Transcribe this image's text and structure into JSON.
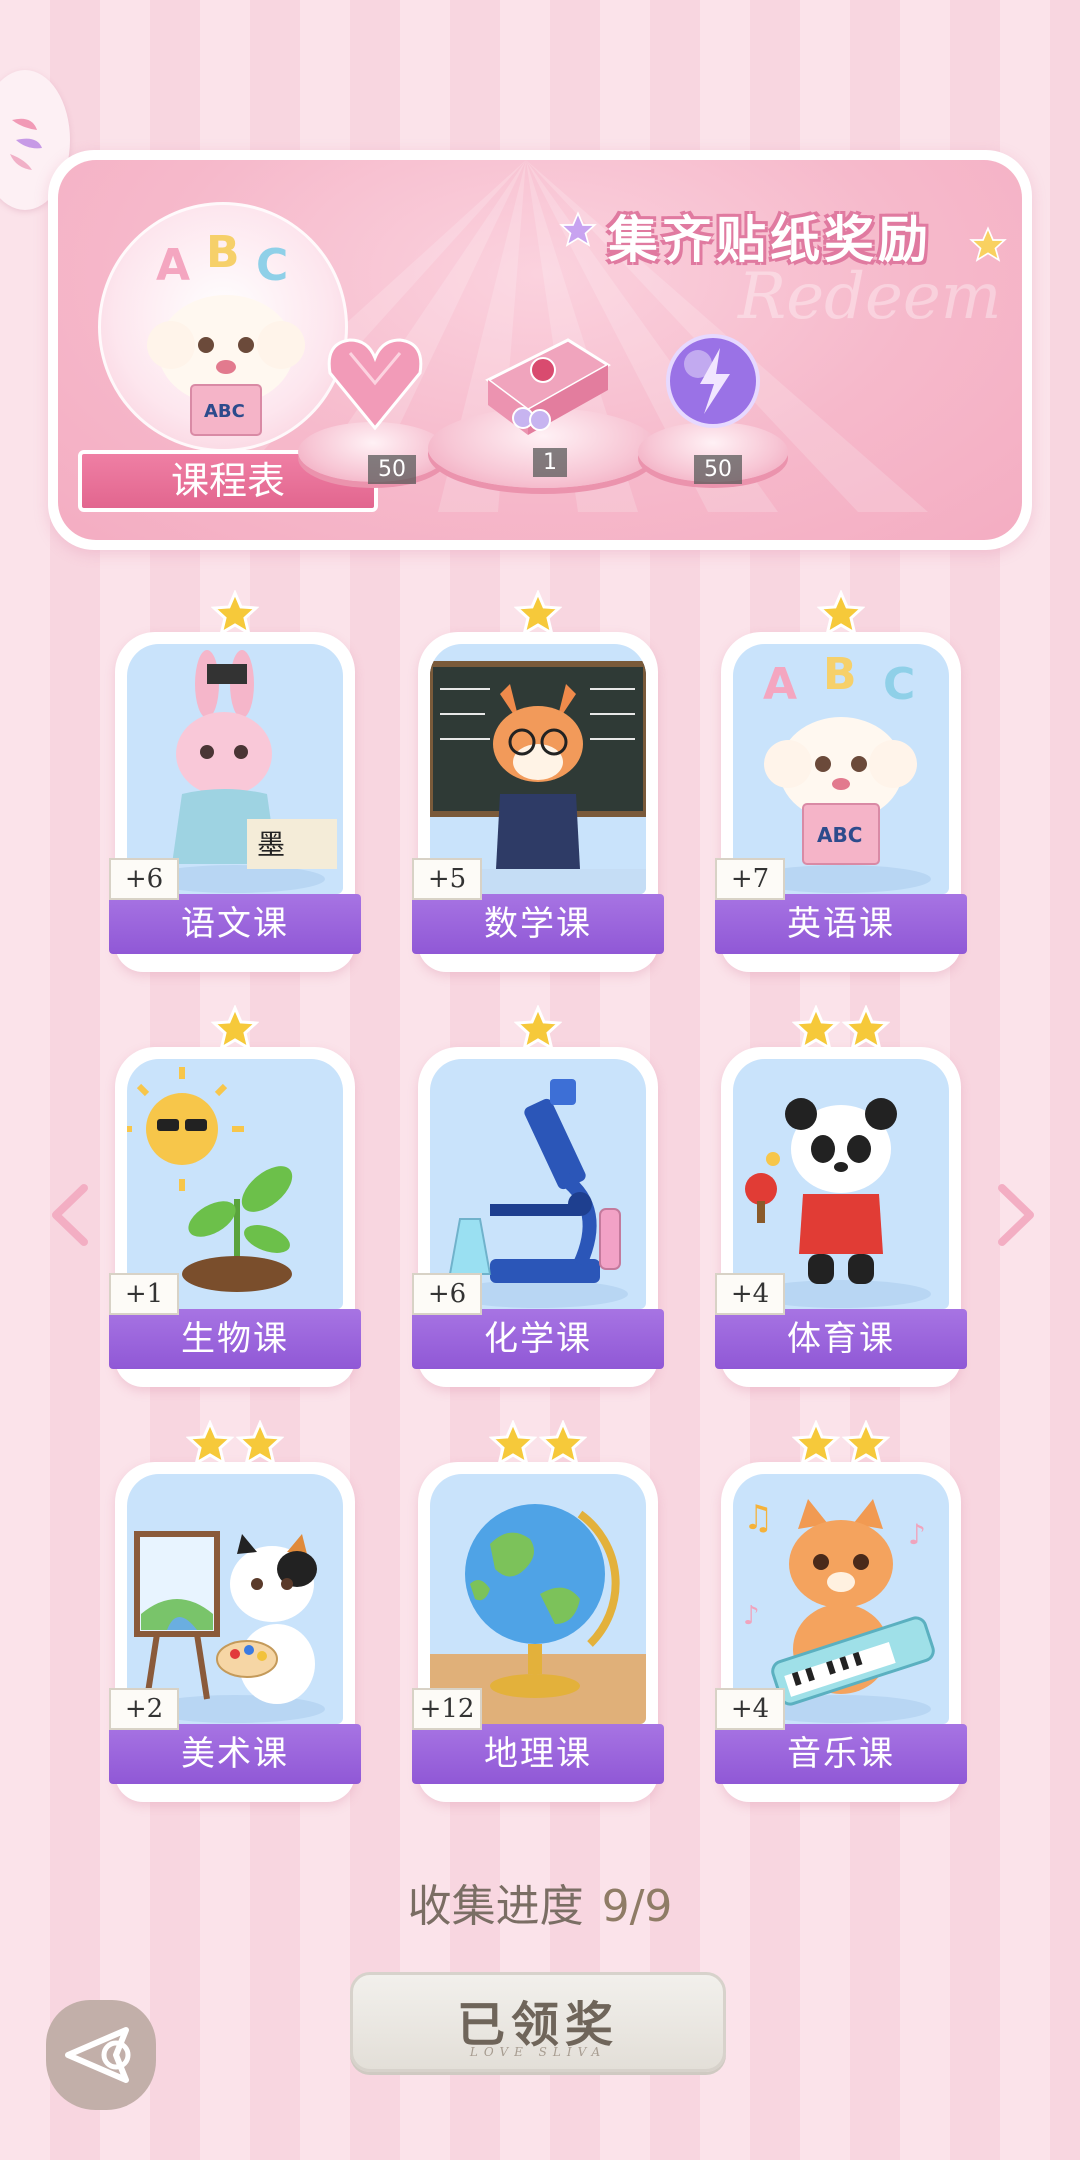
{
  "banner": {
    "title": "集齐贴纸奖励",
    "watermark": "Redeem",
    "schedule_label": "课程表",
    "schedule_book_text": "ABC",
    "schedule_letters": [
      "A",
      "B",
      "C"
    ],
    "rewards": [
      {
        "icon": "pink-heart-gem-icon",
        "count": "50"
      },
      {
        "icon": "gift-box-icon",
        "count": "1"
      },
      {
        "icon": "purple-energy-orb-icon",
        "count": "50"
      }
    ]
  },
  "cards": [
    {
      "label": "语文课",
      "count": "+6",
      "stars": 1,
      "icon": "bunny-calligraphy-icon"
    },
    {
      "label": "数学课",
      "count": "+5",
      "stars": 1,
      "icon": "fox-teacher-icon"
    },
    {
      "label": "英语课",
      "count": "+7",
      "stars": 1,
      "icon": "puppy-abc-book-icon"
    },
    {
      "label": "生物课",
      "count": "+1",
      "stars": 1,
      "icon": "sun-sprout-icon"
    },
    {
      "label": "化学课",
      "count": "+6",
      "stars": 1,
      "icon": "microscope-icon"
    },
    {
      "label": "体育课",
      "count": "+4",
      "stars": 2,
      "icon": "panda-pingpong-icon"
    },
    {
      "label": "美术课",
      "count": "+2",
      "stars": 2,
      "icon": "cat-painter-icon"
    },
    {
      "label": "地理课",
      "count": "+12",
      "stars": 2,
      "icon": "globe-icon"
    },
    {
      "label": "音乐课",
      "count": "+4",
      "stars": 2,
      "icon": "cat-keyboard-icon"
    }
  ],
  "card_art_text": {
    "english_book": "ABC",
    "english_letters": [
      "A",
      "B",
      "C"
    ]
  },
  "progress": {
    "label": "收集进度",
    "value": "9/9"
  },
  "claim_button": {
    "label": "已领奖",
    "sub": "LOVE SLIVA"
  },
  "colors": {
    "card_label": "#9b63dc",
    "banner_pink": "#f4adc2",
    "star": "#f6c93a"
  }
}
